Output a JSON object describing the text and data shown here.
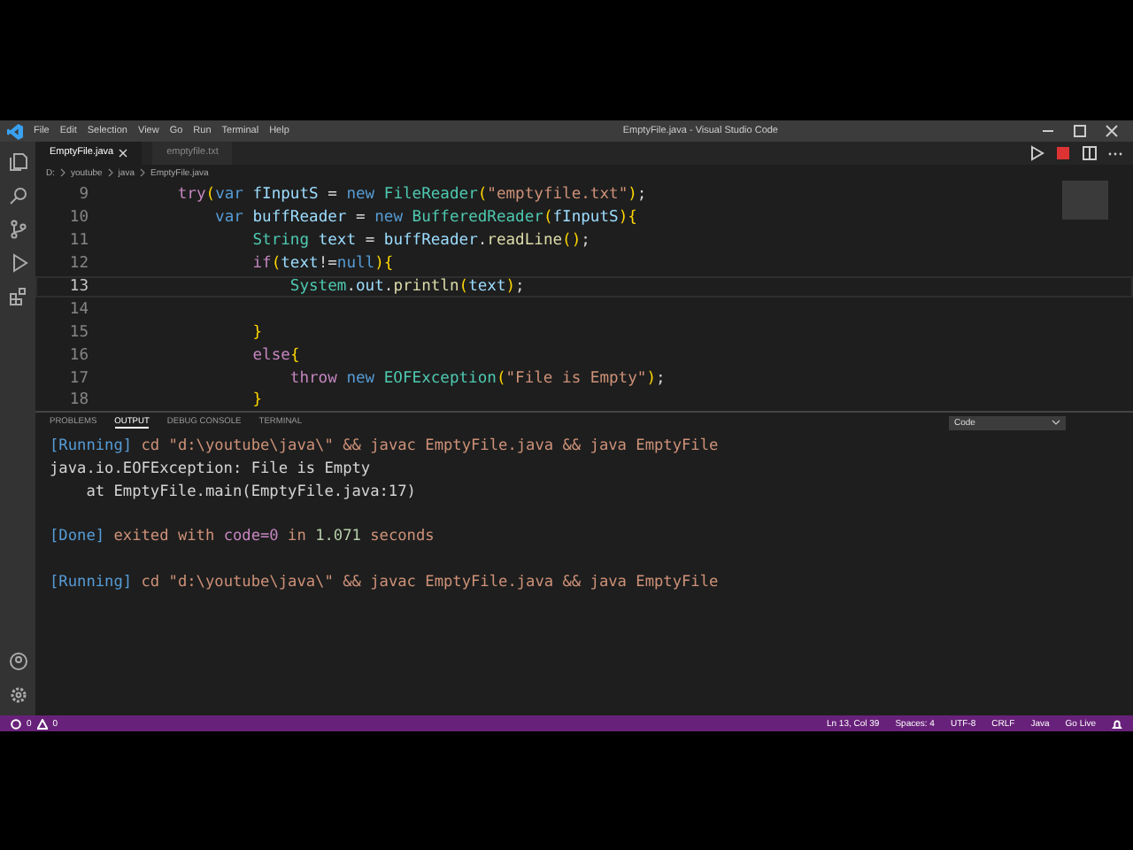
{
  "menu": [
    "File",
    "Edit",
    "Selection",
    "View",
    "Go",
    "Run",
    "Terminal",
    "Help"
  ],
  "window": {
    "title": "EmptyFile.java - Visual Studio Code"
  },
  "tabs": [
    {
      "label": "EmptyFile.java",
      "selected": true
    },
    {
      "label": "emptyfile.txt",
      "selected": false
    }
  ],
  "breadcrumb": [
    "D:",
    "youtube",
    "java",
    "EmptyFile.java"
  ],
  "editor": {
    "lines": [
      {
        "number": "9",
        "current": false,
        "tokens": [
          {
            "kind": "control",
            "text": "        try"
          },
          {
            "kind": "bracket",
            "text": "("
          },
          {
            "kind": "keyword",
            "text": "var"
          },
          {
            "kind": "variable",
            "text": " fInputS "
          },
          {
            "kind": "plain",
            "text": "= "
          },
          {
            "kind": "keyword",
            "text": "new "
          },
          {
            "kind": "type",
            "text": "FileReader"
          },
          {
            "kind": "bracket",
            "text": "("
          },
          {
            "kind": "string",
            "text": "\"emptyfile.txt\""
          },
          {
            "kind": "bracket",
            "text": ")"
          },
          {
            "kind": "plain",
            "text": ";"
          }
        ]
      },
      {
        "number": "10",
        "current": false,
        "tokens": [
          {
            "kind": "keyword",
            "text": "            var"
          },
          {
            "kind": "variable",
            "text": " buffReader "
          },
          {
            "kind": "plain",
            "text": "= "
          },
          {
            "kind": "keyword",
            "text": "new "
          },
          {
            "kind": "type",
            "text": "BufferedReader"
          },
          {
            "kind": "bracket",
            "text": "("
          },
          {
            "kind": "variable",
            "text": "fInputS"
          },
          {
            "kind": "bracket",
            "text": "){"
          }
        ]
      },
      {
        "number": "11",
        "current": false,
        "tokens": [
          {
            "kind": "type",
            "text": "                String"
          },
          {
            "kind": "variable",
            "text": " text "
          },
          {
            "kind": "plain",
            "text": "= "
          },
          {
            "kind": "variable",
            "text": "buffReader"
          },
          {
            "kind": "plain",
            "text": "."
          },
          {
            "kind": "function",
            "text": "readLine"
          },
          {
            "kind": "bracket",
            "text": "()"
          },
          {
            "kind": "plain",
            "text": ";"
          }
        ]
      },
      {
        "number": "12",
        "current": false,
        "tokens": [
          {
            "kind": "control",
            "text": "                if"
          },
          {
            "kind": "bracket",
            "text": "("
          },
          {
            "kind": "variable",
            "text": "text"
          },
          {
            "kind": "plain",
            "text": "!="
          },
          {
            "kind": "keyword",
            "text": "null"
          },
          {
            "kind": "bracket",
            "text": "){"
          }
        ]
      },
      {
        "number": "13",
        "current": true,
        "tokens": [
          {
            "kind": "type",
            "text": "                    System"
          },
          {
            "kind": "plain",
            "text": "."
          },
          {
            "kind": "variable",
            "text": "out"
          },
          {
            "kind": "plain",
            "text": "."
          },
          {
            "kind": "function",
            "text": "println"
          },
          {
            "kind": "bracket",
            "text": "("
          },
          {
            "kind": "variable",
            "text": "text"
          },
          {
            "kind": "bracket",
            "text": ")"
          },
          {
            "kind": "plain",
            "text": ";"
          }
        ]
      },
      {
        "number": "14",
        "current": false
      },
      {
        "number": "15",
        "current": false,
        "tokens": [
          {
            "kind": "bracket",
            "text": "                }"
          }
        ]
      },
      {
        "number": "16",
        "current": false,
        "tokens": [
          {
            "kind": "control",
            "text": "                else"
          },
          {
            "kind": "bracket",
            "text": "{"
          }
        ]
      },
      {
        "number": "17",
        "current": false,
        "tokens": [
          {
            "kind": "control",
            "text": "                    throw "
          },
          {
            "kind": "keyword",
            "text": "new "
          },
          {
            "kind": "type",
            "text": "EOFException"
          },
          {
            "kind": "bracket",
            "text": "("
          },
          {
            "kind": "string",
            "text": "\"File is Empty\""
          },
          {
            "kind": "bracket",
            "text": ")"
          },
          {
            "kind": "plain",
            "text": ";"
          }
        ]
      },
      {
        "number": "18",
        "current": false,
        "tokens": [
          {
            "kind": "bracket",
            "text": "                }"
          }
        ]
      }
    ]
  },
  "panel": {
    "tabs": [
      {
        "label": "PROBLEMS",
        "selected": false
      },
      {
        "label": "OUTPUT",
        "selected": true
      },
      {
        "label": "DEBUG CONSOLE",
        "selected": false
      },
      {
        "label": "TERMINAL",
        "selected": false
      }
    ],
    "channel": "Code",
    "output": [
      {
        "blank_before": false,
        "tokens": [
          {
            "kind": "tag",
            "text": "[Running]"
          },
          {
            "kind": "string",
            "text": " cd \"d:\\youtube\\java\\\" && javac EmptyFile.java && java EmptyFile"
          }
        ]
      },
      {
        "blank_before": false,
        "tokens": [
          {
            "kind": "plain",
            "text": "java.io.EOFException: File is Empty"
          }
        ]
      },
      {
        "blank_before": false,
        "tokens": [
          {
            "kind": "plain",
            "text": "    at EmptyFile.main(EmptyFile.java:17)"
          }
        ]
      },
      {
        "blank_before": true,
        "tokens": [
          {
            "kind": "tag",
            "text": "[Done]"
          },
          {
            "kind": "string",
            "text": " exited with "
          },
          {
            "kind": "control",
            "text": "code=0"
          },
          {
            "kind": "string",
            "text": " in "
          },
          {
            "kind": "number",
            "text": "1.071"
          },
          {
            "kind": "string",
            "text": " seconds"
          }
        ]
      },
      {
        "blank_before": true,
        "tokens": [
          {
            "kind": "tag",
            "text": "[Running]"
          },
          {
            "kind": "string",
            "text": " cd \"d:\\youtube\\java\\\" && javac EmptyFile.java && java EmptyFile"
          }
        ]
      }
    ]
  },
  "status_bar": {
    "errors": "0",
    "warnings": "0",
    "items": [
      "Ln 13, Col 39",
      "Spaces: 4",
      "UTF-8",
      "CRLF",
      "Java",
      "Go Live"
    ]
  }
}
